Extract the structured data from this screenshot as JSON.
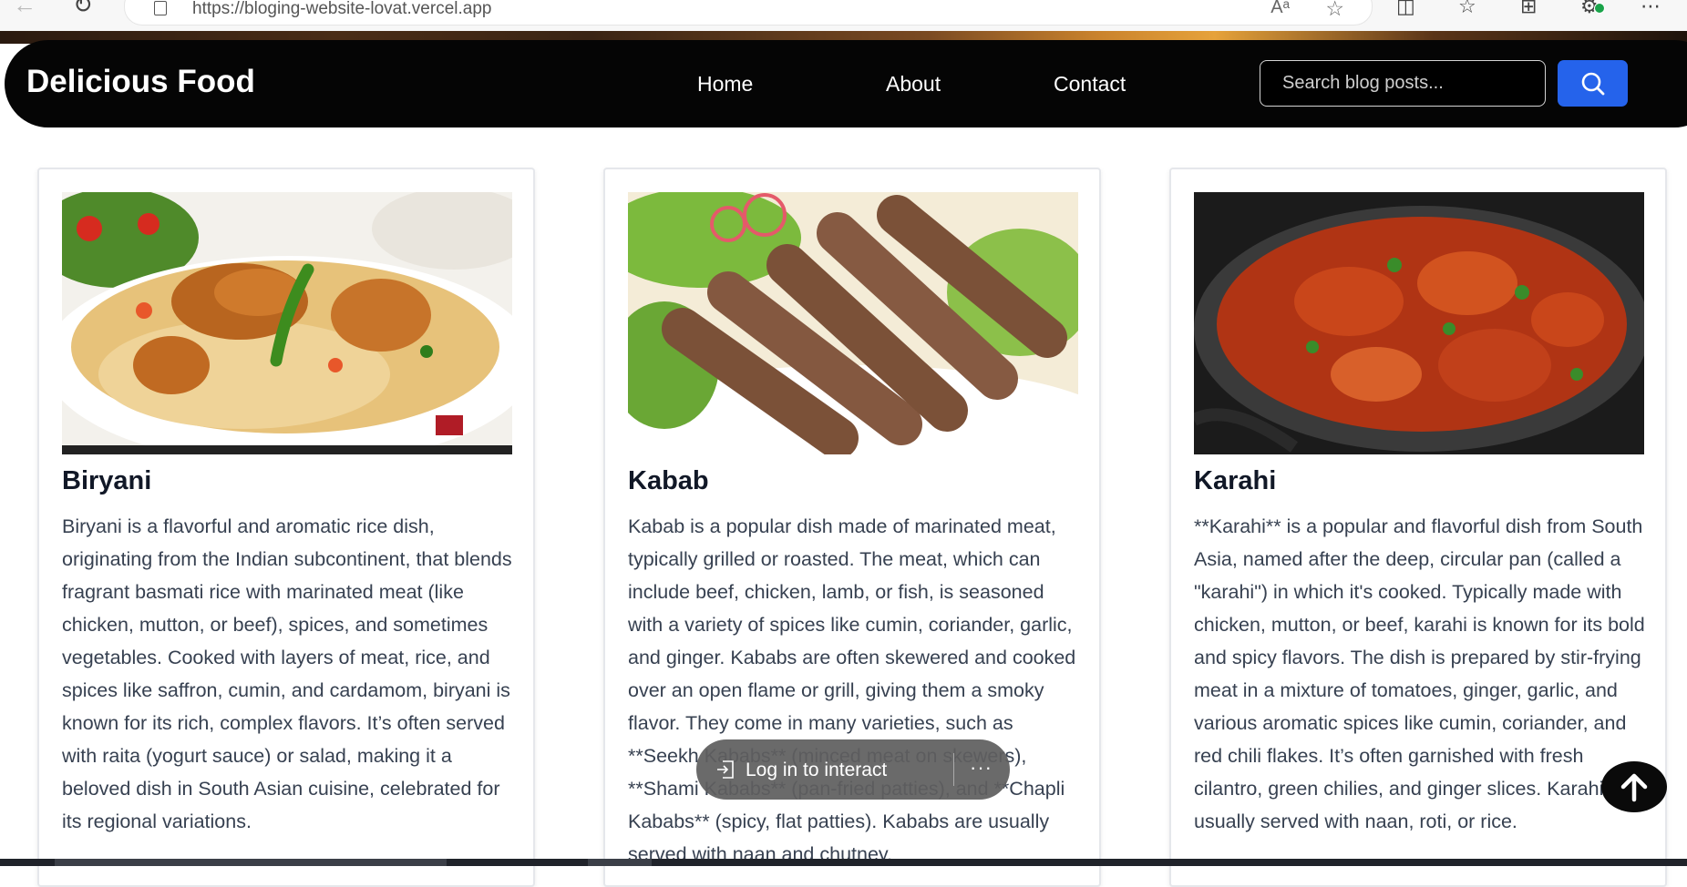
{
  "browser": {
    "url": "https://bloging-website-lovat.vercel.app",
    "reader_label": "Aᵃ"
  },
  "header": {
    "brand": "Delicious Food",
    "nav": [
      {
        "label": "Home"
      },
      {
        "label": "About"
      },
      {
        "label": "Contact"
      }
    ],
    "search_placeholder": "Search blog posts..."
  },
  "posts": [
    {
      "title": "Biryani",
      "image_icon": "biryani-image",
      "body": "Biryani is a flavorful and aromatic rice dish, originating from the Indian subcontinent, that blends fragrant basmati rice with marinated meat (like chicken, mutton, or beef), spices, and sometimes vegetables. Cooked with layers of meat, rice, and spices like saffron, cumin, and cardamom, biryani is known for its rich, complex flavors. It’s often served with raita (yogurt sauce) or salad, making it a beloved dish in South Asian cuisine, celebrated for its regional variations."
    },
    {
      "title": "Kabab",
      "image_icon": "kabab-image",
      "body": "Kabab is a popular dish made of marinated meat, typically grilled or roasted. The meat, which can include beef, chicken, lamb, or fish, is seasoned with a variety of spices like cumin, coriander, garlic, and ginger. Kababs are often skewered and cooked over an open flame or grill, giving them a smoky flavor. They come in many varieties, such as **Seekh Kababs** (minced meat on skewers), **Shami Kababs** (pan-fried patties), and **Chapli Kababs** (spicy, flat patties). Kababs are usually served with naan and chutney."
    },
    {
      "title": "Karahi",
      "image_icon": "karahi-image",
      "body": "**Karahi** is a popular and flavorful dish from South Asia, named after the deep, circular pan (called a \"karahi\") in which it's cooked. Typically made with chicken, mutton, or beef, karahi is known for its bold and spicy flavors. The dish is prepared by stir-frying meat in a mixture of tomatoes, ginger, garlic, and various aromatic spices like cumin, coriander, and red chili flakes. It’s often garnished with fresh cilantro, green chilies, and ginger slices. Karahi is usually served with naan, roti, or rice."
    }
  ],
  "overlay": {
    "login_label": "Log in to interact",
    "more_label": "···"
  },
  "colors": {
    "header_bg": "#050505",
    "search_button": "#2563eb"
  }
}
